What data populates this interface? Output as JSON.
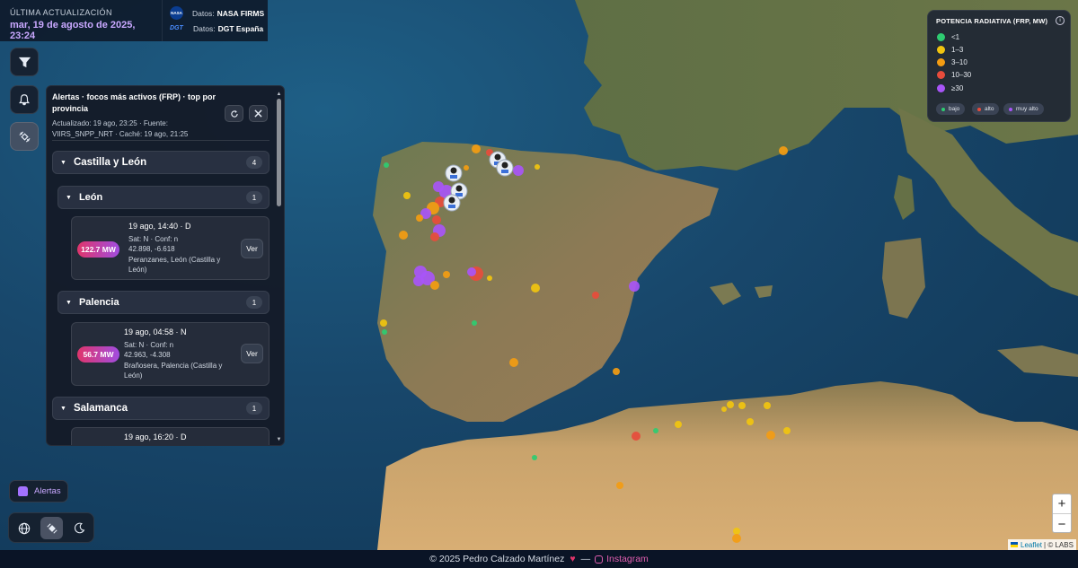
{
  "header": {
    "update_label": "ÚLTIMA ACTUALIZACIÓN",
    "update_date": "mar, 19 de agosto de 2025, 23:24",
    "source1_prefix": "Datos:",
    "source1_name": "NASA FIRMS",
    "source2_prefix": "Datos:",
    "source2_name": "DGT España",
    "nasa_logo_text": "NASA",
    "dgt_logo_text": "DGT"
  },
  "panel": {
    "title": "Alertas · focos más activos (FRP) · top por provincia",
    "subtitle": "Actualizado: 19 ago, 23:25 · Fuente: VIIRS_SNPP_NRT · Caché: 19 ago, 21:25",
    "groups": [
      {
        "name": "Castilla y León",
        "count": "4"
      }
    ],
    "subgroups": [
      {
        "name": "León",
        "count": "1"
      },
      {
        "name": "Palencia",
        "count": "1"
      },
      {
        "name": "Salamanca",
        "count": "1"
      }
    ],
    "cards": [
      {
        "frp": "122.7 MW",
        "time": "19 ago, 14:40 · D",
        "sat": "Sat: N · Conf: n",
        "coords": "42.898, -6.618",
        "place": "Peranzanes, León (Castilla y León)",
        "button": "Ver"
      },
      {
        "frp": "56.7 MW",
        "time": "19 ago, 04:58 · N",
        "sat": "Sat: N · Conf: n",
        "coords": "42.963, -4.308",
        "place": "Brañosera, Palencia (Castilla y León)",
        "button": "Ver"
      },
      {
        "frp": "",
        "time": "19 ago, 16:20 · D",
        "sat": "",
        "coords": "",
        "place": "",
        "button": ""
      }
    ]
  },
  "legend": {
    "title": "POTENCIA RADIATIVA (FRP, MW)",
    "items": [
      {
        "label": "<1",
        "color": "#2ecc71"
      },
      {
        "label": "1–3",
        "color": "#f1c40f"
      },
      {
        "label": "3–10",
        "color": "#f39c12"
      },
      {
        "label": "10–30",
        "color": "#e74c3c"
      },
      {
        "label": "≥30",
        "color": "#a855f7"
      }
    ],
    "pills": [
      {
        "label": "bajo",
        "color": "#2ecc71"
      },
      {
        "label": "alto",
        "color": "#e74c3c"
      },
      {
        "label": "muy alto",
        "color": "#a855f7"
      }
    ]
  },
  "controls": {
    "alerts_label": "Alertas",
    "zoom_in": "+",
    "zoom_out": "−"
  },
  "attribution": {
    "leaflet": "Leaflet",
    "rest": "| © LABS"
  },
  "footer": {
    "copyright": "© 2025 Pedro Calzado Martínez",
    "sep": "—",
    "instagram": "Instagram"
  }
}
